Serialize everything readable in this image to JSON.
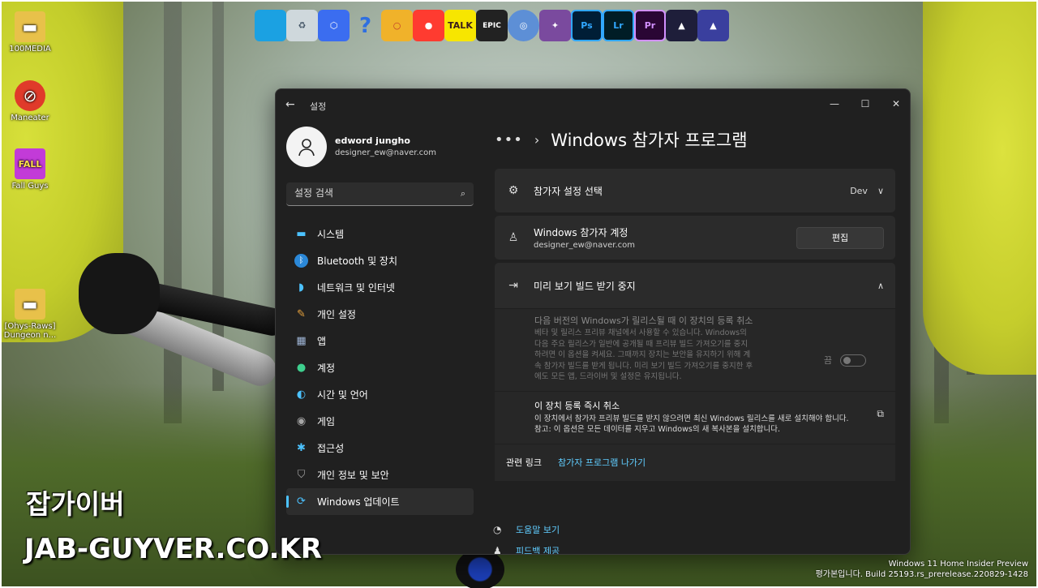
{
  "desktop": {
    "icons": [
      {
        "label": "100MEDIA",
        "icon": "folder-icon"
      },
      {
        "label": "Maneater",
        "icon": "game-shortcut-icon"
      },
      {
        "label": "Fall Guys",
        "icon": "game-shortcut-icon"
      },
      {
        "label": "[Ohys-Raws] Dungeon n...",
        "icon": "folder-icon"
      }
    ],
    "top_icons": [
      {
        "name": "monitor-icon",
        "text": "",
        "color": "#1ba1e2"
      },
      {
        "name": "recycle-bin-icon",
        "text": "",
        "color": "#cfd8dc"
      },
      {
        "name": "app-icon",
        "text": "",
        "color": "#3b6df0"
      },
      {
        "name": "help-icon",
        "text": "?",
        "color": "#2f6fe0"
      },
      {
        "name": "search-app-icon",
        "text": "",
        "color": "#f0b22a"
      },
      {
        "name": "nox-icon",
        "text": "",
        "color": "#ff3b30"
      },
      {
        "name": "kakaotalk-icon",
        "text": "TALK",
        "color": "#f7e600"
      },
      {
        "name": "epic-games-icon",
        "text": "EPIC",
        "color": "#222222"
      },
      {
        "name": "globe-icon",
        "text": "",
        "color": "#5d8fd6"
      },
      {
        "name": "game-icon",
        "text": "",
        "color": "#7a4a9e"
      },
      {
        "name": "photoshop-icon",
        "text": "Ps",
        "color": "#001e36"
      },
      {
        "name": "lightroom-icon",
        "text": "Lr",
        "color": "#001d26"
      },
      {
        "name": "premiere-icon",
        "text": "Pr",
        "color": "#2a0634"
      },
      {
        "name": "affinity-icon",
        "text": "",
        "color": "#1e1e3a"
      },
      {
        "name": "affinity-photo-icon",
        "text": "",
        "color": "#3a3f9e"
      }
    ]
  },
  "window": {
    "title": "설정",
    "profile": {
      "name": "edword jungho",
      "email": "designer_ew@naver.com"
    },
    "search_placeholder": "설정 검색",
    "nav": [
      {
        "label": "시스템",
        "icon": "system-icon",
        "color": "#4cc2ff"
      },
      {
        "label": "Bluetooth 및 장치",
        "icon": "bluetooth-icon",
        "color": "#2b88d8"
      },
      {
        "label": "네트워크 및 인터넷",
        "icon": "wifi-icon",
        "color": "#4cc2ff"
      },
      {
        "label": "개인 설정",
        "icon": "brush-icon",
        "color": "#e8a33d"
      },
      {
        "label": "앱",
        "icon": "apps-icon",
        "color": "#9fb5d6"
      },
      {
        "label": "계정",
        "icon": "account-icon",
        "color": "#3ecf8e"
      },
      {
        "label": "시간 및 언어",
        "icon": "clock-globe-icon",
        "color": "#4cc2ff"
      },
      {
        "label": "게임",
        "icon": "gamepad-icon",
        "color": "#a6a6a6"
      },
      {
        "label": "접근성",
        "icon": "accessibility-icon",
        "color": "#4cc2ff"
      },
      {
        "label": "개인 정보 및 보안",
        "icon": "shield-icon",
        "color": "#a6a6a6"
      },
      {
        "label": "Windows 업데이트",
        "icon": "update-icon",
        "color": "#4cc2ff"
      }
    ],
    "breadcrumb": {
      "dots": "•••",
      "title": "Windows 참가자 프로그램"
    },
    "settings": {
      "channel": {
        "label": "참가자 설정 선택",
        "value": "Dev"
      },
      "account": {
        "label": "Windows 참가자 계정",
        "email": "designer_ew@naver.com",
        "button": "편집"
      },
      "stop": {
        "label": "미리 보기 빌드 받기 중지",
        "unenroll_title": "다음 버전의 Windows가 릴리스될 때 이 장치의 등록 취소",
        "unenroll_desc": "베타 및 릴리스 프리뷰 채널에서 사용할 수 있습니다. Windows의 다음 주요 릴리스가 일반에 공개될 때 프리뷰 빌드 가져오기를 중지하려면 이 옵션을 켜세요. 그때까지 장치는 보안을 유지하기 위해 계속 참가자 빌드를 받게 됩니다. 미리 보기 빌드 가져오기를 중지한 후에도 모든 앱, 드라이버 및 설정은 유지됩니다.",
        "toggle_label": "끔",
        "toggle_on": false,
        "immediate_title": "이 장치 등록 즉시 취소",
        "immediate_desc": "이 장치에서 참가자 프리뷰 빌드를 받지 않으려면 최신 Windows 릴리스를 새로 설치해야 합니다. 참고: 이 옵션은 모든 데이터를 지우고 Windows의 새 복사본을 설치합니다."
      },
      "related_label": "관련 링크",
      "related_link": "참가자 프로그램 나가기"
    },
    "help": {
      "help_label": "도움말 보기",
      "feedback_label": "피드백 제공"
    }
  },
  "watermark": {
    "line1": "잡가이버",
    "line2": "JAB-GUYVER.CO.KR"
  },
  "build": {
    "line1": "Windows 11 Home Insider Preview",
    "line2": "평가본입니다. Build 25193.rs_prerelease.220829-1428"
  }
}
